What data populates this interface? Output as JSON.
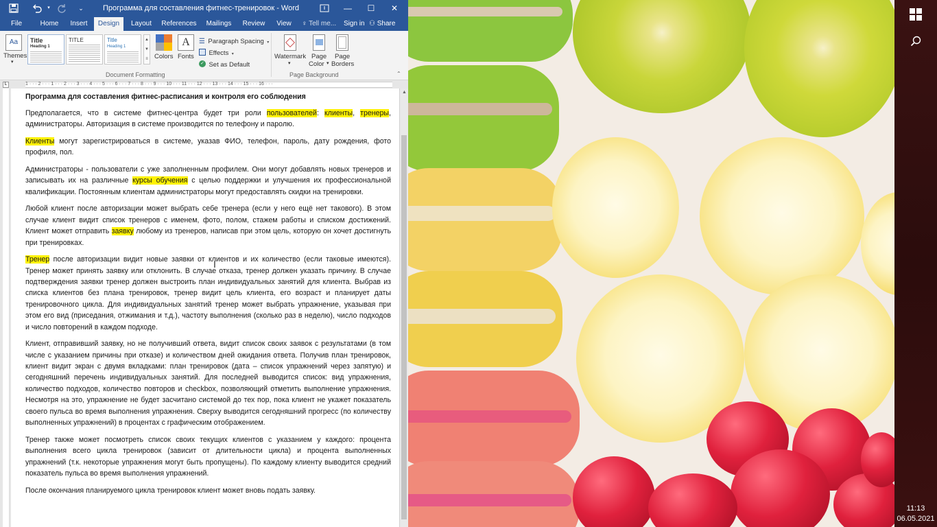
{
  "window": {
    "title": "Программа для составления фитнес-тренировок - Word"
  },
  "quick_access": {
    "save_icon": "save-icon",
    "undo_icon": "undo-icon",
    "redo_icon": "redo-icon",
    "customize_icon": "customize-icon"
  },
  "window_controls": {
    "ribbon_options_icon": "ribbon-display-icon",
    "minimize": "—",
    "maximize": "☐",
    "close": "✕"
  },
  "tabs": [
    "File",
    "Home",
    "Insert",
    "Design",
    "Layout",
    "References",
    "Mailings",
    "Review",
    "View"
  ],
  "active_tab": "Design",
  "tab_right": {
    "tell_me": "Tell me...",
    "sign_in": "Sign in",
    "share": "Share"
  },
  "ribbon": {
    "themes_label": "Themes",
    "style_boxes": [
      {
        "title": "Title",
        "heading": "Heading 1"
      },
      {
        "title": "TITLE",
        "heading": ""
      },
      {
        "title": "Title",
        "heading": "Heading 1"
      }
    ],
    "colors_label": "Colors",
    "fonts_label": "Fonts",
    "paragraph_spacing": "Paragraph Spacing",
    "effects": "Effects",
    "set_as_default": "Set as Default",
    "group_document_formatting": "Document Formatting",
    "watermark": "Watermark",
    "page_color_line1": "Page",
    "page_color_line2": "Color",
    "page_borders_line1": "Page",
    "page_borders_line2": "Borders",
    "group_page_background": "Page Background"
  },
  "document": {
    "heading": "Программа для составления фитнес-расписания и контроля его соблюдения",
    "p1": {
      "a": "Предполагается, что в системе фитнес-центра будет три роли ",
      "hl1": "пользователей",
      "b": ": ",
      "hl2": "клиенты",
      "c": ", ",
      "hl3": "тренеры",
      "d": ", администраторы. Авторизация в системе производится по телефону и паролю."
    },
    "p2": {
      "hl1": "Клиенты",
      "a": " могут зарегистрироваться в системе, указав ФИО, телефон, пароль, дату рождения, фото профиля, пол."
    },
    "p3": {
      "a": "Администраторы - пользователи с уже заполненным профилем. Они могут добавлять новых тренеров и записывать их на различные ",
      "hl1": "курсы обучения",
      "b": " с целью поддержки и улучшения их профессиональной квалификации. Постоянным клиентам администраторы могут предоставлять скидки на тренировки."
    },
    "p4": {
      "a": "Любой клиент после авторизации может выбрать себе тренера (если у него ещё нет такового). В этом случае клиент видит список тренеров с именем, фото, полом, стажем работы и списком достижений. Клиент может отправить ",
      "hl1": "заявку",
      "b": " любому из тренеров, написав при этом цель, которую он хочет достигнуть при тренировках."
    },
    "p5": {
      "hl1": "Тренер",
      "a": " после авторизации видит новые заявки от клиентов и их количество (если таковые имеются). Тренер может принять заявку или отклонить. В случае отказа, тренер должен указать причину. В случае подтверждения заявки тренер должен выстроить план индивидуальных занятий для клиента. Выбрав из списка клиентов без плана тренировок, тренер видит цель клиента, его возраст и планирует даты тренировочного цикла. Для индивидуальных занятий тренер может выбрать упражнение, указывая при этом его вид (приседания, отжимания и т.д.), частоту выполнения (сколько раз в неделю), число подходов и число повторений в каждом подходе."
    },
    "p6": "Клиент, отправивший заявку, но не получивший ответа, видит список своих заявок с результатами (в том числе с указанием причины при отказе) и количеством дней ожидания ответа. Получив план тренировок, клиент видит экран с двумя вкладками: план тренировок (дата – список упражнений через запятую) и сегодняшний перечень индивидуальных занятий. Для последней выводится список: вид упражнения, количество подходов, количество повторов и checkbox, позволяющий отметить выполнение упражнения. Несмотря на это, упражнение не будет засчитано системой до тех пор, пока клиент не укажет показатель своего пульса во время выполнения упражнения. Сверху выводится сегодняшний прогресс (по количеству выполненных упражнений) в процентах с графическим отображением.",
    "p7": "Тренер также может посмотреть список своих текущих клиентов с указанием у каждого: процента выполнения всего цикла тренировок (зависит от длительности цикла) и процента выполненных упражнений (т.к. некоторые упражнения могут быть пропущены). По каждому клиенту выводится средний показатель пульса во время выполнения упражнений.",
    "p8": "После окончания планируемого цикла тренировок клиент может вновь подать заявку."
  },
  "ruler_text": "1 · · · 2 · · · 1 · · · 2 · · · 3 · · · 4 · · · 5 · · · 6 · · · 7 · · · 8 · · · 9 · · · 10 · · · 11 · · · 12 · · · 13 · · · 14 · · · 15 · · · 16 · · ·",
  "taskbar": {
    "time": "11:13",
    "date": "06.05.2021",
    "start_icon": "windows-start-icon",
    "search_icon": "search-icon"
  },
  "colors": {
    "word_blue": "#2b579a",
    "highlight": "#fff200",
    "taskbar": "#2b0c0c"
  }
}
